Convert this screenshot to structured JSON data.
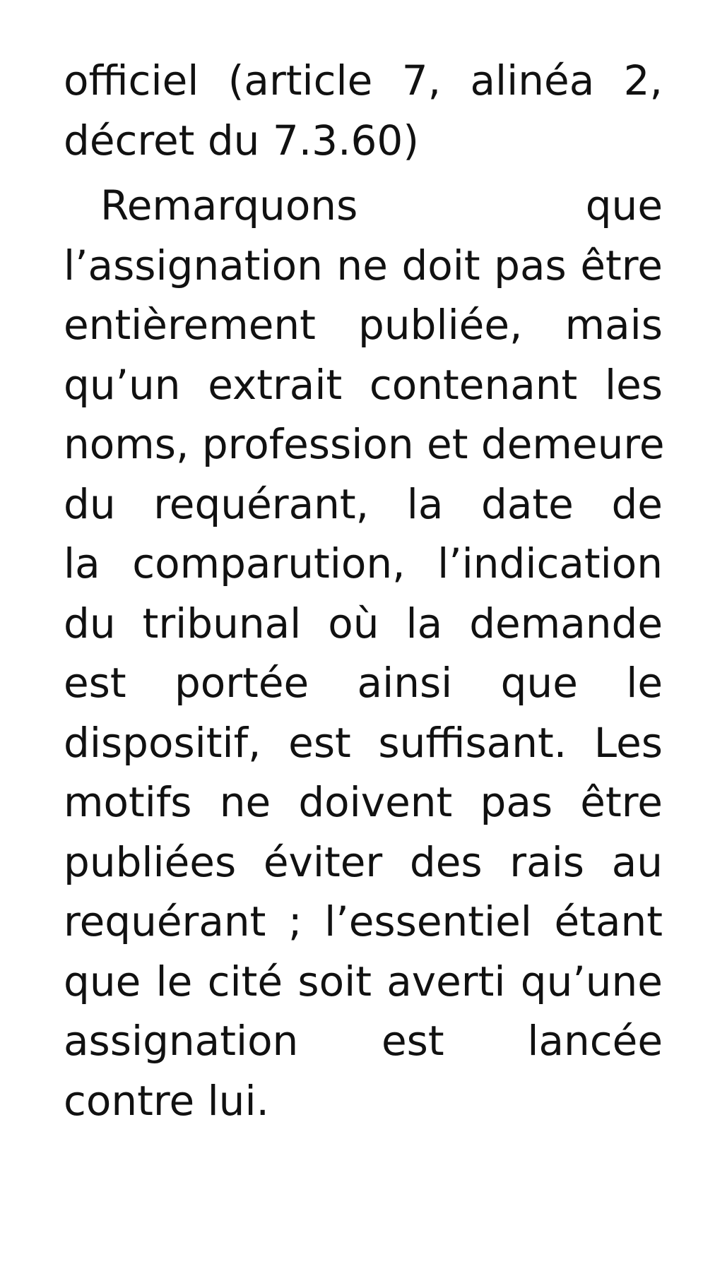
{
  "document": {
    "paragraph_1": {
      "lines": [
        "officiel (article 7, alinéa 2,",
        "décret du 7.3.60)"
      ]
    },
    "paragraph_2": {
      "lines": [
        "Remarquons que",
        "l’assignation ne doit pas être",
        "entièrement publiée, mais",
        "qu’un extrait contenant les",
        "noms, profession et demeure",
        "du requérant, la date de",
        "la comparution, l’indication",
        "du tribunal où la demande",
        "est portée ainsi que le",
        "dispositif, est suffisant. Les",
        "motifs ne doivent pas être",
        "publiées éviter des rais au",
        "requérant ; l’essentiel étant",
        "que le cité soit averti qu’une",
        "assignation est lancée",
        "contre lui."
      ]
    }
  }
}
